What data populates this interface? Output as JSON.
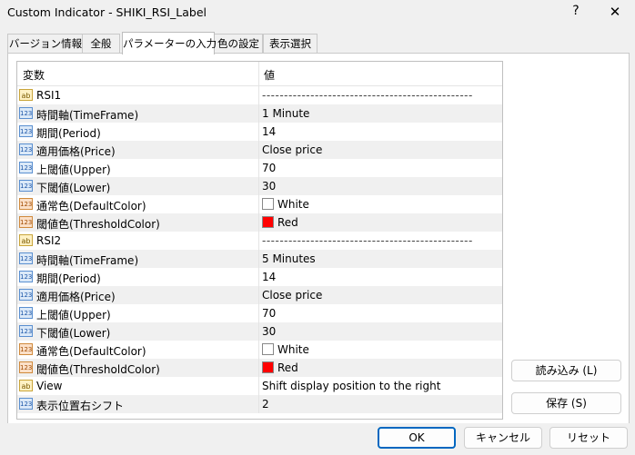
{
  "window": {
    "title": "Custom Indicator - SHIKI_RSI_Label",
    "help": "?",
    "close": "✕"
  },
  "tabs": [
    {
      "label": "バージョン情報"
    },
    {
      "label": "全般"
    },
    {
      "label": "パラメーターの入力"
    },
    {
      "label": "色の設定"
    },
    {
      "label": "表示選択"
    }
  ],
  "active_tab": "パラメーターの入力",
  "grid": {
    "header": {
      "name": "変数",
      "value": "値"
    },
    "rows": [
      {
        "icon": "ab",
        "name": "RSI1",
        "value": "------------------------------------------------",
        "swatch": ""
      },
      {
        "icon": "123",
        "name": "時間軸(TimeFrame)",
        "value": "1 Minute",
        "swatch": ""
      },
      {
        "icon": "123",
        "name": "期間(Period)",
        "value": "14",
        "swatch": ""
      },
      {
        "icon": "123",
        "name": "適用価格(Price)",
        "value": "Close price",
        "swatch": ""
      },
      {
        "icon": "123",
        "name": "上閾値(Upper)",
        "value": "70",
        "swatch": ""
      },
      {
        "icon": "123",
        "name": "下閾値(Lower)",
        "value": "30",
        "swatch": ""
      },
      {
        "icon": "123",
        "name": "通常色(DefaultColor)",
        "value": "White",
        "swatch": "#ffffff"
      },
      {
        "icon": "123",
        "name": "閾値色(ThresholdColor)",
        "value": "Red",
        "swatch": "#ff0000"
      },
      {
        "icon": "ab",
        "name": "RSI2",
        "value": "------------------------------------------------",
        "swatch": ""
      },
      {
        "icon": "123",
        "name": "時間軸(TimeFrame)",
        "value": "5 Minutes",
        "swatch": ""
      },
      {
        "icon": "123",
        "name": "期間(Period)",
        "value": "14",
        "swatch": ""
      },
      {
        "icon": "123",
        "name": "適用価格(Price)",
        "value": "Close price",
        "swatch": ""
      },
      {
        "icon": "123",
        "name": "上閾値(Upper)",
        "value": "70",
        "swatch": ""
      },
      {
        "icon": "123",
        "name": "下閾値(Lower)",
        "value": "30",
        "swatch": ""
      },
      {
        "icon": "123",
        "name": "通常色(DefaultColor)",
        "value": "White",
        "swatch": "#ffffff"
      },
      {
        "icon": "123",
        "name": "閾値色(ThresholdColor)",
        "value": "Red",
        "swatch": "#ff0000"
      },
      {
        "icon": "ab",
        "name": "View",
        "value": "Shift display position to the right",
        "swatch": ""
      },
      {
        "icon": "123",
        "name": "表示位置右シフト",
        "value": "2",
        "swatch": ""
      }
    ]
  },
  "side_buttons": {
    "load": "読み込み (L)",
    "save": "保存 (S)"
  },
  "footer_buttons": {
    "ok": "OK",
    "cancel": "キャンセル",
    "reset": "リセット"
  }
}
